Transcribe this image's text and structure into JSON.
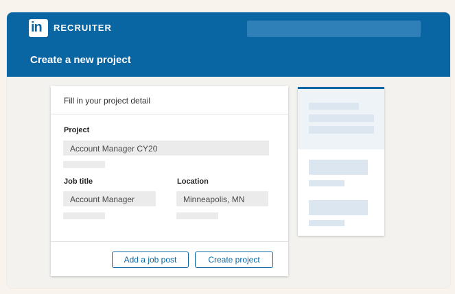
{
  "header": {
    "brand": "RECRUITER",
    "logo_text": "in",
    "page_title": "Create a new project"
  },
  "form": {
    "heading": "Fill in your project detail",
    "project_label": "Project",
    "project_value": "Account Manager CY20",
    "job_title_label": "Job title",
    "job_title_value": "Account Manager",
    "location_label": "Location",
    "location_value": "Minneapolis, MN"
  },
  "actions": {
    "add_job_post": "Add a job post",
    "create_project": "Create project"
  },
  "colors": {
    "brand_blue": "#0a66a3",
    "search_placeholder_blue": "#2f80b8"
  },
  "icons": {
    "logo": "linkedin-logo"
  }
}
